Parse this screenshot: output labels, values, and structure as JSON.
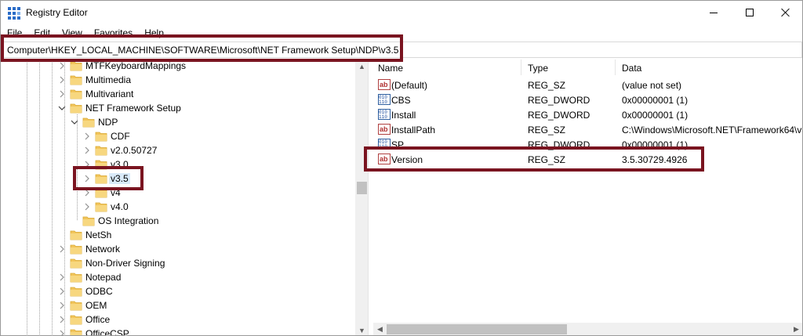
{
  "window": {
    "title": "Registry Editor"
  },
  "menu": [
    "File",
    "Edit",
    "View",
    "Favorites",
    "Help"
  ],
  "address": "Computer\\HKEY_LOCAL_MACHINE\\SOFTWARE\\Microsoft\\NET Framework Setup\\NDP\\v3.5",
  "tree": [
    {
      "label": "MTFKeyboardMappings",
      "expander": "collapsed",
      "depth": 0
    },
    {
      "label": "Multimedia",
      "expander": "collapsed",
      "depth": 0
    },
    {
      "label": "Multivariant",
      "expander": "collapsed",
      "depth": 0
    },
    {
      "label": "NET Framework Setup",
      "expander": "expanded",
      "depth": 0
    },
    {
      "label": "NDP",
      "expander": "expanded",
      "depth": 1
    },
    {
      "label": "CDF",
      "expander": "collapsed",
      "depth": 2
    },
    {
      "label": "v2.0.50727",
      "expander": "collapsed",
      "depth": 2
    },
    {
      "label": "v3.0",
      "expander": "collapsed",
      "depth": 2
    },
    {
      "label": "v3.5",
      "expander": "collapsed",
      "depth": 2,
      "selected": true
    },
    {
      "label": "v4",
      "expander": "collapsed",
      "depth": 2
    },
    {
      "label": "v4.0",
      "expander": "collapsed",
      "depth": 2
    },
    {
      "label": "OS Integration",
      "expander": "none",
      "depth": 1
    },
    {
      "label": "NetSh",
      "expander": "none",
      "depth": 0
    },
    {
      "label": "Network",
      "expander": "collapsed",
      "depth": 0
    },
    {
      "label": "Non-Driver Signing",
      "expander": "none",
      "depth": 0
    },
    {
      "label": "Notepad",
      "expander": "collapsed",
      "depth": 0
    },
    {
      "label": "ODBC",
      "expander": "collapsed",
      "depth": 0
    },
    {
      "label": "OEM",
      "expander": "collapsed",
      "depth": 0
    },
    {
      "label": "Office",
      "expander": "collapsed",
      "depth": 0
    },
    {
      "label": "OfficeCSP",
      "expander": "collapsed",
      "depth": 0
    }
  ],
  "list": {
    "columns": {
      "name": "Name",
      "type": "Type",
      "data": "Data"
    },
    "rows": [
      {
        "name": "(Default)",
        "type": "REG_SZ",
        "data": "(value not set)",
        "icon": "string-value-icon"
      },
      {
        "name": "CBS",
        "type": "REG_DWORD",
        "data": "0x00000001 (1)",
        "icon": "dword-value-icon"
      },
      {
        "name": "Install",
        "type": "REG_DWORD",
        "data": "0x00000001 (1)",
        "icon": "dword-value-icon"
      },
      {
        "name": "InstallPath",
        "type": "REG_SZ",
        "data": "C:\\Windows\\Microsoft.NET\\Framework64\\v",
        "icon": "string-value-icon"
      },
      {
        "name": "SP",
        "type": "REG_DWORD",
        "data": "0x00000001 (1)",
        "icon": "dword-value-icon"
      },
      {
        "name": "Version",
        "type": "REG_SZ",
        "data": "3.5.30729.4926",
        "icon": "string-value-icon"
      }
    ]
  },
  "colors": {
    "highlight": "#7a1420",
    "folder": "#f2c55c",
    "selection": "#d9eaf9"
  }
}
